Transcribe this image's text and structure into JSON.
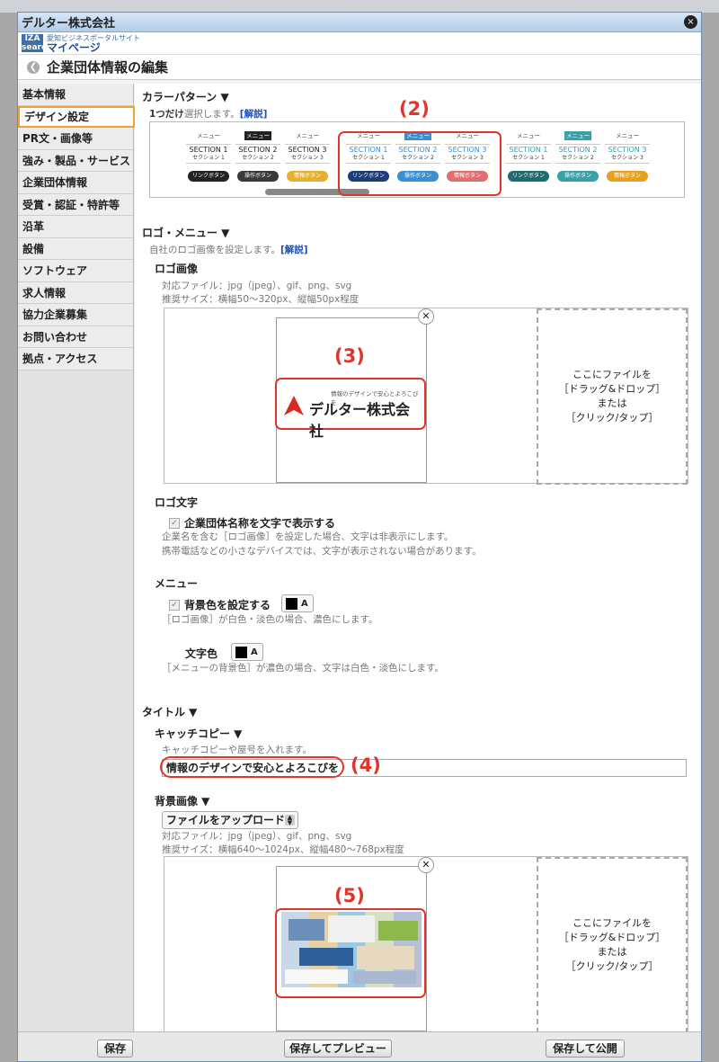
{
  "window": {
    "title": "デルター株式会社",
    "close_label": "×"
  },
  "brand": {
    "logo_text": "IZA search",
    "sub": "愛知ビジネスポータルサイト",
    "main": "マイページ"
  },
  "page": {
    "title": "企業団体情報の編集"
  },
  "sidebar": {
    "items": [
      {
        "label": "基本情報"
      },
      {
        "label": "デザイン設定"
      },
      {
        "label": "PR文・画像等"
      },
      {
        "label": "強み・製品・サービス"
      },
      {
        "label": "企業団体情報"
      },
      {
        "label": "受賞・認証・特許等"
      },
      {
        "label": "沿革"
      },
      {
        "label": "設備"
      },
      {
        "label": "ソフトウェア"
      },
      {
        "label": "求人情報"
      },
      {
        "label": "協力企業募集"
      },
      {
        "label": "お問い合わせ"
      },
      {
        "label": "拠点・アクセス"
      }
    ]
  },
  "color_pattern": {
    "heading": "カラーパターン ▼",
    "note_prefix": "1つだけ",
    "note_rest": "選択します。",
    "link": "[解説]",
    "menu_label": "メニュー",
    "section_labels": [
      "SECTION 1",
      "SECTION 2",
      "SECTION 3"
    ],
    "section_sub": [
      "セクション 1",
      "セクション 2",
      "セクション 3"
    ],
    "button_labels": [
      "リンクボタン",
      "操作ボタン",
      "情報ボタン"
    ],
    "annotation": "(2)",
    "themes": [
      {
        "accent": "#222222",
        "pills": [
          "#222222",
          "#3a3a3a",
          "#e6b030"
        ]
      },
      {
        "accent": "#3b8fd0",
        "pills": [
          "#1d3c7a",
          "#3b8fd0",
          "#e07070"
        ]
      },
      {
        "accent": "#3aa0a8",
        "pills": [
          "#1e6b70",
          "#3aa0a8",
          "#e8a020"
        ]
      }
    ]
  },
  "logo_menu": {
    "heading": "ロゴ・メニュー ▼",
    "note": "自社のロゴ画像を設定します。",
    "link": "[解説]",
    "logo_image": {
      "heading": "ロゴ画像",
      "formats": "対応ファイル：jpg（jpeg）、gif、png、svg",
      "size": "推奨サイズ：横幅50～320px、縦幅50px程度",
      "logo_tagline": "情報のデザインで安心とよろこびを",
      "logo_name": "デルター株式会社",
      "annotation": "(3)"
    },
    "drop_lines": [
      "ここにファイルを",
      "［ドラッグ&ドロップ］",
      "または",
      "［クリック/タップ］"
    ],
    "logo_text": {
      "heading": "ロゴ文字",
      "checkbox_label": "企業団体名称を文字で表示する",
      "note1": "企業名を含む［ロゴ画像］を設定した場合、文字は非表示にします。",
      "note2": "携帯電話などの小さなデバイスでは、文字が表示されない場合があります。"
    },
    "menu": {
      "heading": "メニュー",
      "bg_checkbox_label": "背景色を設定する",
      "bg_note": "［ロゴ画像］が白色・淡色の場合、濃色にします。",
      "text_color_label": "文字色",
      "text_color_note": "［メニューの背景色］が濃色の場合、文字は白色・淡色にします。",
      "swatch_letter": "A",
      "swatch_color": "#000000"
    }
  },
  "title_section": {
    "heading": "タイトル ▼",
    "catch": {
      "heading": "キャッチコピー ▼",
      "note": "キャッチコピーや屋号を入れます。",
      "value": "情報のデザインで安心とよろこびを",
      "annotation": "(4)"
    },
    "bg_image": {
      "heading": "背景画像 ▼",
      "select_value": "ファイルをアップロード",
      "formats": "対応ファイル：jpg（jpeg）、gif、png、svg",
      "size": "推奨サイズ：横幅640～1024px、縦幅480～768px程度",
      "annotation": "(5)"
    }
  },
  "footer": {
    "save": "保存",
    "save_preview": "保存してプレビュー",
    "save_publish": "保存して公開"
  },
  "accent_color": "#e0352b"
}
